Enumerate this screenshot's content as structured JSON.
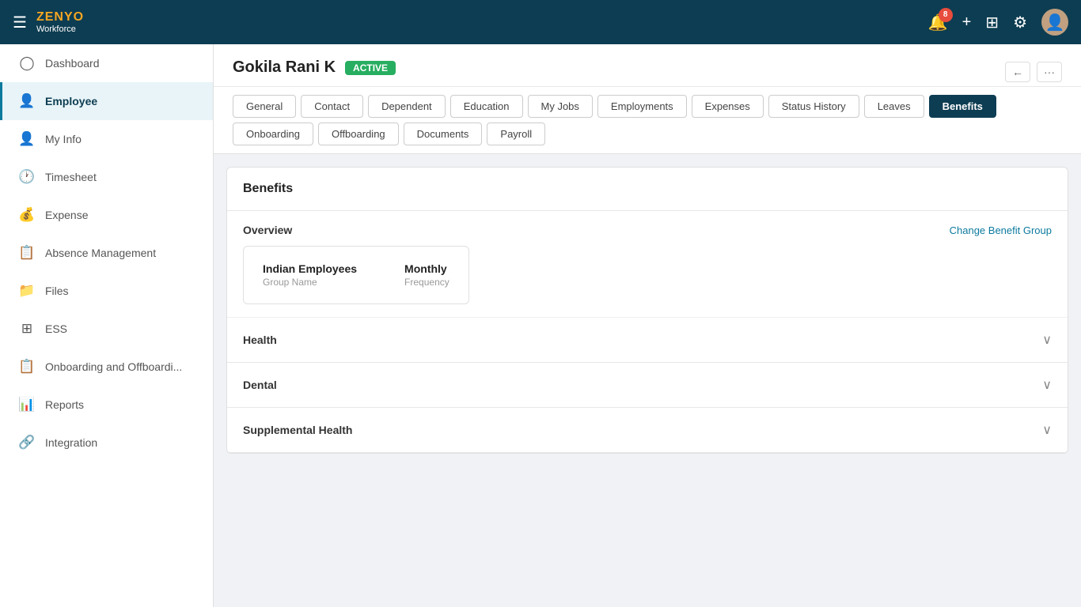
{
  "topnav": {
    "logo_zenyo": "ZENYO",
    "logo_workforce": "Workforce",
    "notification_count": "8",
    "hamburger_icon": "☰",
    "add_icon": "+",
    "grid_icon": "⊞",
    "settings_icon": "⚙",
    "avatar_icon": "👤"
  },
  "sidebar": {
    "items": [
      {
        "id": "dashboard",
        "label": "Dashboard",
        "icon": "○"
      },
      {
        "id": "employee",
        "label": "Employee",
        "icon": "👤",
        "active": true
      },
      {
        "id": "myinfo",
        "label": "My Info",
        "icon": "👤"
      },
      {
        "id": "timesheet",
        "label": "Timesheet",
        "icon": "🕐"
      },
      {
        "id": "expense",
        "label": "Expense",
        "icon": "👥"
      },
      {
        "id": "absence",
        "label": "Absence Management",
        "icon": "📋"
      },
      {
        "id": "files",
        "label": "Files",
        "icon": "📁"
      },
      {
        "id": "ess",
        "label": "ESS",
        "icon": "⊞"
      },
      {
        "id": "onboarding",
        "label": "Onboarding and Offboardi...",
        "icon": "📋"
      },
      {
        "id": "reports",
        "label": "Reports",
        "icon": "📊"
      },
      {
        "id": "integration",
        "label": "Integration",
        "icon": "🔗"
      }
    ]
  },
  "page": {
    "employee_name": "Gokila Rani K",
    "status": "ACTIVE",
    "back_button": "←",
    "more_button": "···"
  },
  "tabs": [
    {
      "id": "general",
      "label": "General"
    },
    {
      "id": "contact",
      "label": "Contact"
    },
    {
      "id": "dependent",
      "label": "Dependent"
    },
    {
      "id": "education",
      "label": "Education"
    },
    {
      "id": "myjobs",
      "label": "My Jobs"
    },
    {
      "id": "employments",
      "label": "Employments"
    },
    {
      "id": "expenses",
      "label": "Expenses"
    },
    {
      "id": "statushistory",
      "label": "Status History"
    },
    {
      "id": "leaves",
      "label": "Leaves"
    },
    {
      "id": "benefits",
      "label": "Benefits",
      "active": true
    },
    {
      "id": "onboarding",
      "label": "Onboarding"
    },
    {
      "id": "offboarding",
      "label": "Offboarding"
    },
    {
      "id": "documents",
      "label": "Documents"
    },
    {
      "id": "payroll",
      "label": "Payroll"
    }
  ],
  "benefits": {
    "section_title": "Benefits",
    "overview": {
      "label": "Overview",
      "change_link": "Change Benefit Group",
      "group_name_value": "Indian Employees",
      "group_name_label": "Group Name",
      "frequency_value": "Monthly",
      "frequency_label": "Frequency"
    },
    "collapsible_sections": [
      {
        "id": "health",
        "label": "Health"
      },
      {
        "id": "dental",
        "label": "Dental"
      },
      {
        "id": "supplemental",
        "label": "Supplemental Health"
      }
    ]
  }
}
